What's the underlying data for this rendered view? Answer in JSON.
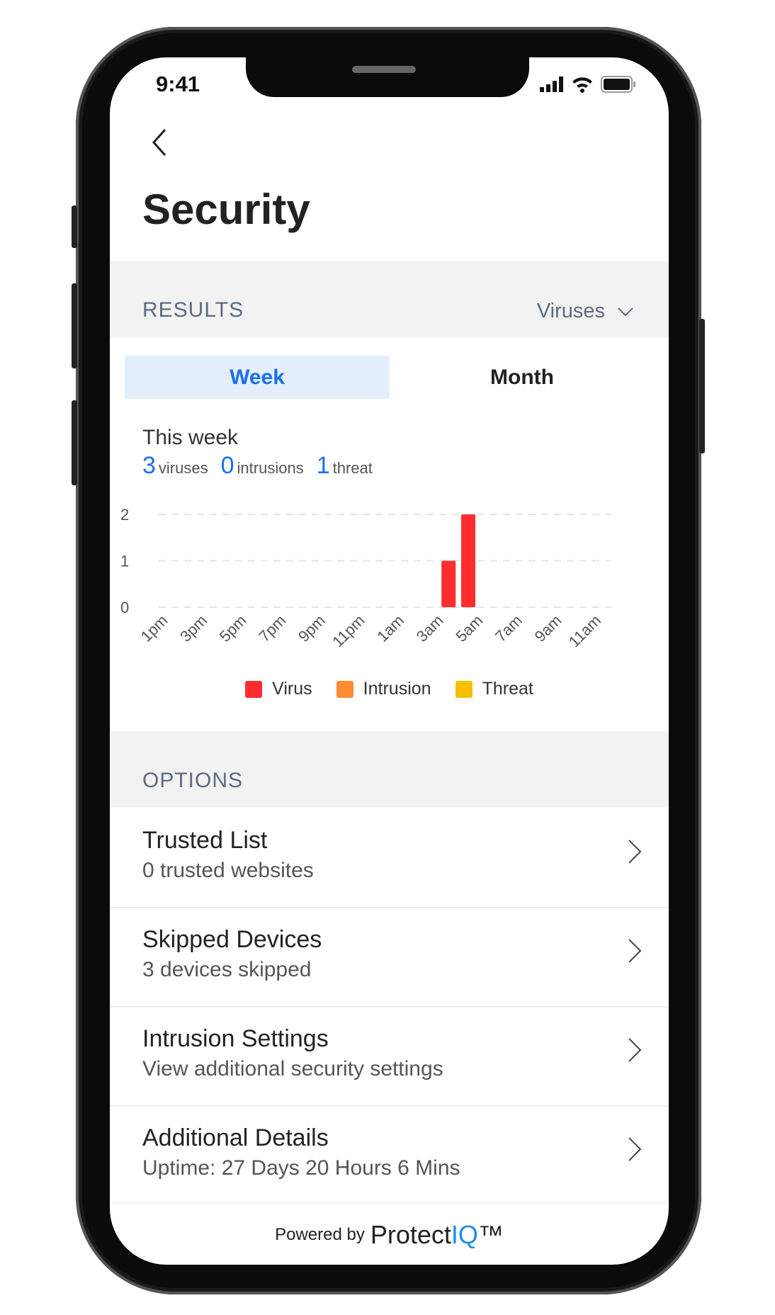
{
  "status_bar": {
    "time": "9:41"
  },
  "header": {
    "title": "Security"
  },
  "results": {
    "label": "RESULTS",
    "filter_selected": "Viruses",
    "tabs": [
      {
        "label": "Week",
        "active": true
      },
      {
        "label": "Month",
        "active": false
      }
    ],
    "period_label": "This week",
    "counts": [
      {
        "value": "3",
        "label": "viruses"
      },
      {
        "value": "0",
        "label": "intrusions"
      },
      {
        "value": "1",
        "label": "threat"
      }
    ]
  },
  "chart_data": {
    "type": "bar",
    "x": [
      "1pm",
      "2pm",
      "3pm",
      "4pm",
      "5pm",
      "6pm",
      "7pm",
      "8pm",
      "9pm",
      "10pm",
      "11pm",
      "12am",
      "1am",
      "2am",
      "3am",
      "4am",
      "5am",
      "6am",
      "7am",
      "8am",
      "9am",
      "10am",
      "11am"
    ],
    "tick_labels": [
      "1pm",
      "3pm",
      "5pm",
      "7pm",
      "9pm",
      "11pm",
      "1am",
      "3am",
      "5am",
      "7am",
      "9am",
      "11am"
    ],
    "series": [
      {
        "name": "Virus",
        "color": "#ff2d2d",
        "values": [
          0,
          0,
          0,
          0,
          0,
          0,
          0,
          0,
          0,
          0,
          0,
          0,
          0,
          0,
          1,
          2,
          0,
          0,
          0,
          0,
          0,
          0,
          0
        ]
      },
      {
        "name": "Intrusion",
        "color": "#ff8c33",
        "values": [
          0,
          0,
          0,
          0,
          0,
          0,
          0,
          0,
          0,
          0,
          0,
          0,
          0,
          0,
          0,
          0,
          0,
          0,
          0,
          0,
          0,
          0,
          0
        ]
      },
      {
        "name": "Threat",
        "color": "#f5c000",
        "values": [
          0,
          0,
          0,
          0,
          0,
          0,
          0,
          0,
          0,
          0,
          0,
          0,
          0,
          0,
          0,
          0,
          0,
          0,
          0,
          0,
          0,
          0,
          0
        ]
      }
    ],
    "y_ticks": [
      "0",
      "1",
      "2"
    ],
    "ylim": [
      0,
      2
    ],
    "grid": true,
    "legend": "bottom"
  },
  "options": {
    "label": "OPTIONS",
    "items": [
      {
        "title": "Trusted List",
        "subtitle": "0 trusted websites"
      },
      {
        "title": "Skipped Devices",
        "subtitle": "3 devices skipped"
      },
      {
        "title": "Intrusion Settings",
        "subtitle": "View additional security settings"
      },
      {
        "title": "Additional Details",
        "subtitle": "Uptime: 27 Days 20 Hours 6 Mins"
      }
    ]
  },
  "footer": {
    "powered_by": "Powered by",
    "brand_main": "Protect",
    "brand_accent": "IQ",
    "trademark": "™"
  },
  "colors": {
    "accent": "#1a6ff2",
    "tab_active_bg": "#e3effd",
    "band_bg": "#f2f2f2"
  }
}
